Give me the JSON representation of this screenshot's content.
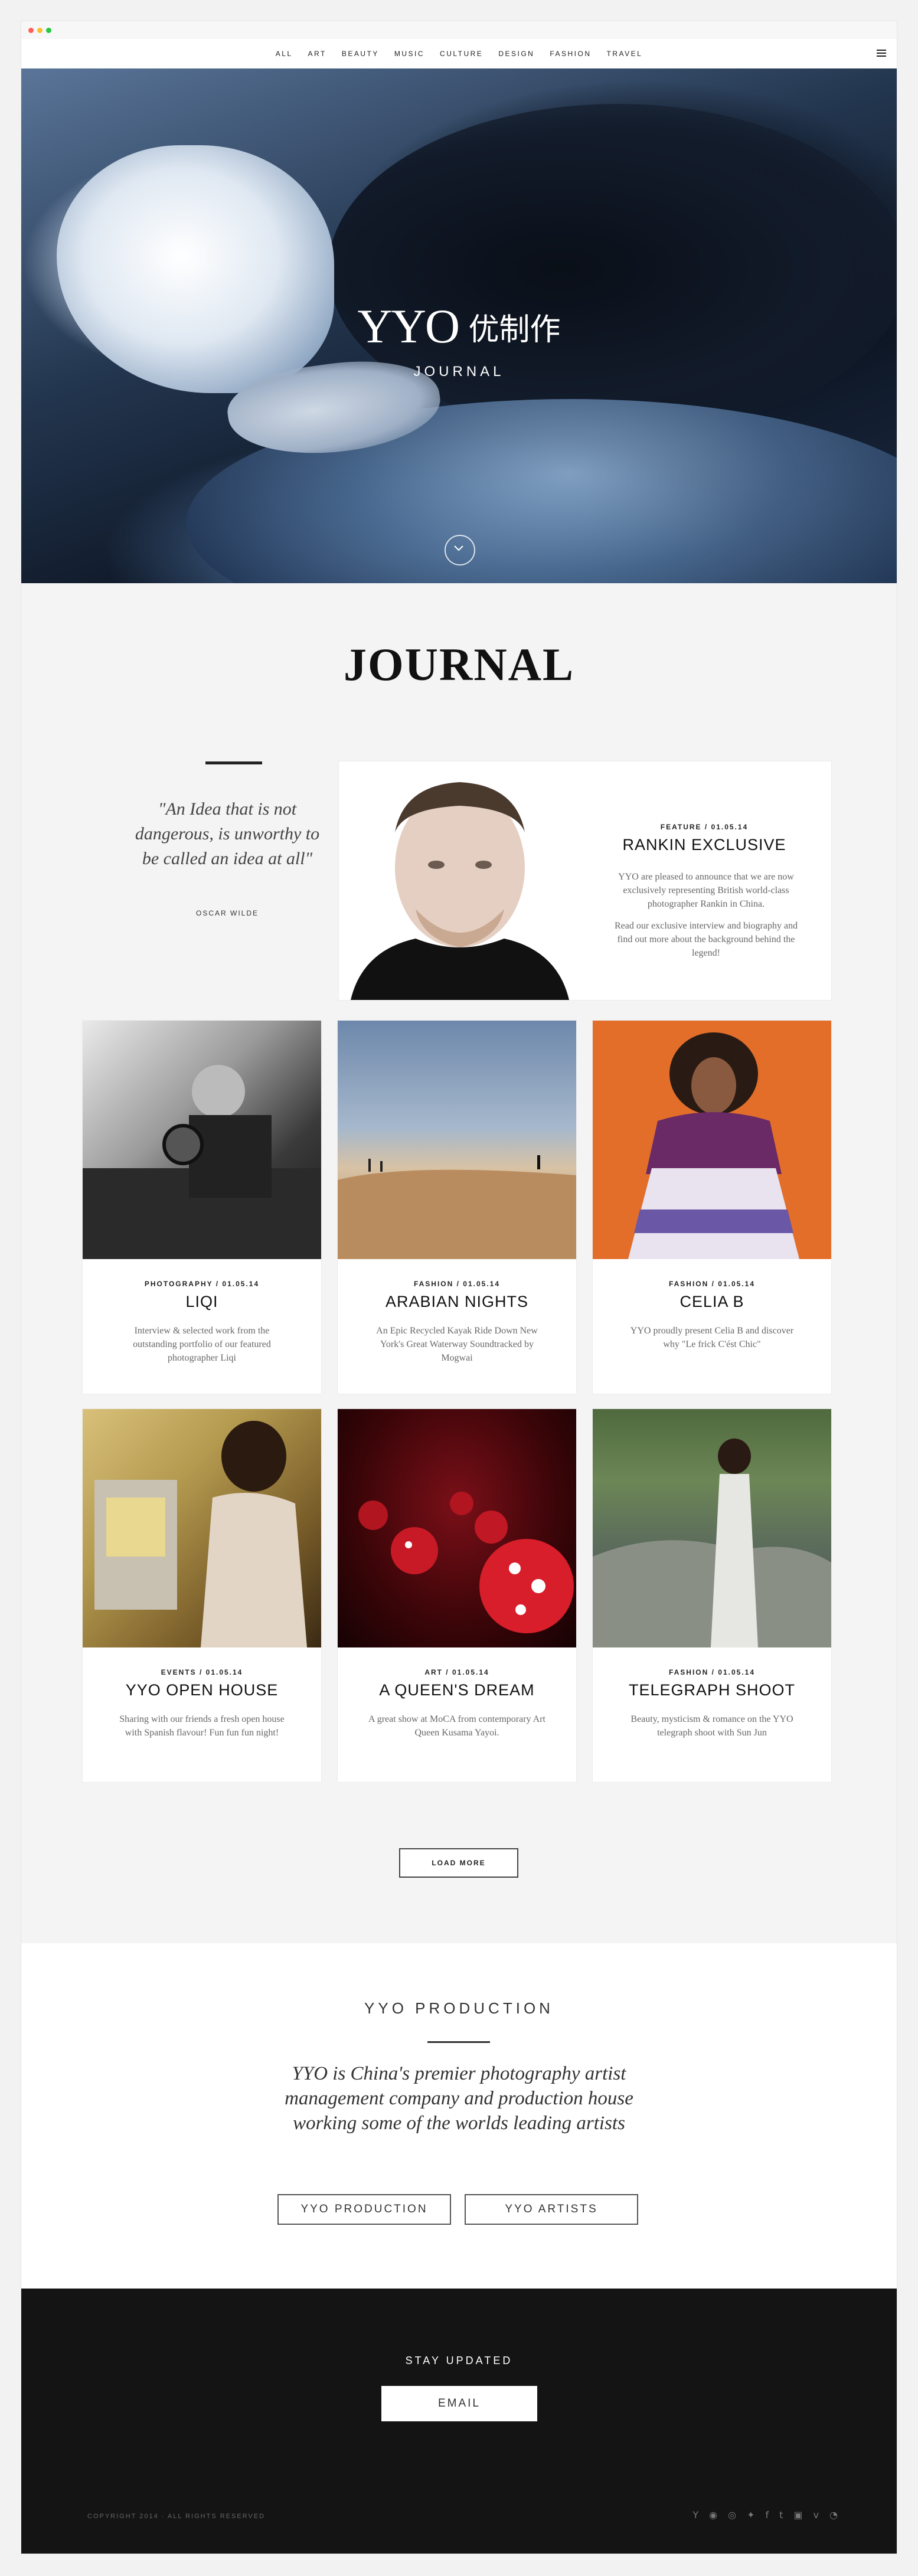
{
  "nav": {
    "items": [
      "ALL",
      "ART",
      "BEAUTY",
      "MUSIC",
      "CULTURE",
      "DESIGN",
      "FASHION",
      "TRAVEL"
    ]
  },
  "hero": {
    "logo_latin": "YYO",
    "logo_chinese": "优制作",
    "subtitle": "JOURNAL"
  },
  "journal": {
    "heading": "JOURNAL"
  },
  "quote": {
    "text": "\"An Idea that is not dangerous, is unworthy to be called an idea at all\"",
    "author": "OSCAR WILDE"
  },
  "featured": {
    "meta": "FEATURE / 01.05.14",
    "title": "RANKIN EXCLUSIVE",
    "desc1": "YYO are pleased to announce that we are now exclusively representing British world-class photographer Rankin in China.",
    "desc2": "Read our exclusive interview and biography and find out more about the background behind the legend!"
  },
  "cards": [
    {
      "meta": "PHOTOGRAPHY / 01.05.14",
      "title": "LIQI",
      "desc": "Interview & selected work from the outstanding portfolio of our featured photographer Liqi"
    },
    {
      "meta": "FASHION / 01.05.14",
      "title": "ARABIAN NIGHTS",
      "desc": "An Epic Recycled Kayak Ride Down New York's Great Waterway Soundtracked by Mogwai"
    },
    {
      "meta": "FASHION / 01.05.14",
      "title": "CELIA B",
      "desc": "YYO proudly present Celia B and discover why \"Le frick C'ést Chic\""
    },
    {
      "meta": "EVENTS / 01.05.14",
      "title": "YYO OPEN HOUSE",
      "desc": "Sharing with our friends a fresh open house with Spanish flavour! Fun fun fun night!"
    },
    {
      "meta": "ART / 01.05.14",
      "title": "A QUEEN'S DREAM",
      "desc": "A great show at MoCA from contemporary Art Queen Kusama Yayoi."
    },
    {
      "meta": "FASHION / 01.05.14",
      "title": "TELEGRAPH SHOOT",
      "desc": "Beauty, mysticism & romance on the YYO telegraph shoot with Sun Jun"
    }
  ],
  "load_more": "LOAD MORE",
  "production": {
    "title": "YYO PRODUCTION",
    "text": "YYO is China's premier photography artist management company and production house working some of the worlds leading artists",
    "btn_production": "YYO PRODUCTION",
    "btn_artists": "YYO ARTISTS"
  },
  "footer": {
    "stay": "STAY UPDATED",
    "email": "EMAIL",
    "copyright": "COPYRIGHT 2014 · ALL RIGHTS RESERVED",
    "socials": [
      "yyo-icon",
      "wechat-icon",
      "weibo-icon",
      "twitter-icon",
      "facebook-icon",
      "tumblr-icon",
      "instagram-icon",
      "vimeo-icon",
      "rss-icon"
    ]
  },
  "colors": {
    "dot_red": "#ff5f57",
    "dot_yellow": "#ffbd2e",
    "dot_green": "#28c840",
    "footer_bg": "#141414"
  }
}
